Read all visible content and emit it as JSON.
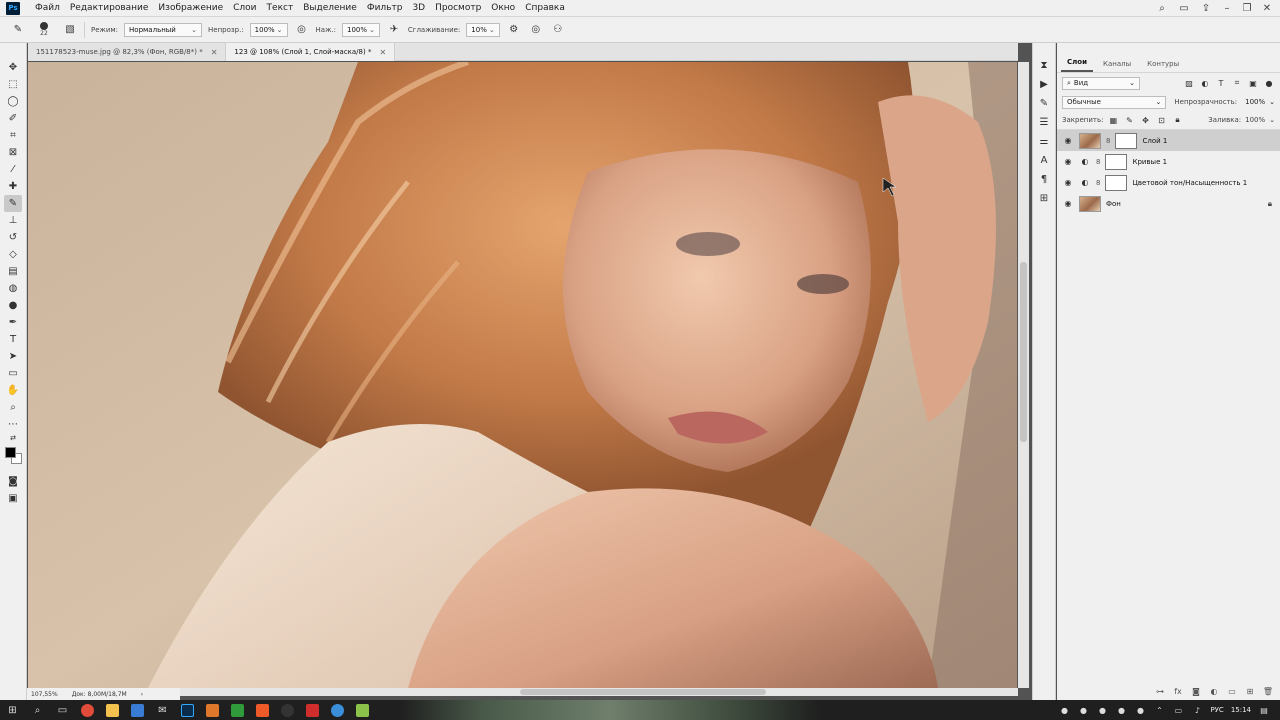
{
  "menu": {
    "logo": "Ps",
    "items": [
      "Файл",
      "Редактирование",
      "Изображение",
      "Слои",
      "Текст",
      "Выделение",
      "Фильтр",
      "3D",
      "Просмотр",
      "Окно",
      "Справка"
    ]
  },
  "options": {
    "brush_size": "22",
    "mode_label": "Режим:",
    "mode_value": "Нормальный",
    "opacity_label": "Непрозр.:",
    "opacity_value": "100%",
    "pressure_label": "Наж.:",
    "pressure_value": "100%",
    "smoothing_label": "Сглаживание:",
    "smoothing_value": "10%"
  },
  "tabs": [
    {
      "label": "151178523-muse.jpg @ 82,3% (Фон, RGB/8*) *"
    },
    {
      "label": "123 @ 108% (Слой 1, Слой-маска/8) *"
    }
  ],
  "status": {
    "zoom": "107,55%",
    "doc": "Док: 8,00M/18,7M"
  },
  "layers_panel": {
    "tabs": [
      "Слои",
      "Каналы",
      "Контуры"
    ],
    "filter_value": "Вид",
    "blend_value": "Обычные",
    "opacity_label": "Непрозрачность:",
    "opacity_value": "100%",
    "lock_label": "Закрепить:",
    "fill_label": "Заливка:",
    "fill_value": "100%",
    "layers": [
      {
        "name": "Слой 1",
        "selected": true
      },
      {
        "name": "Кривые 1",
        "selected": false
      },
      {
        "name": "Цветовой тон/Насыщенность 1",
        "selected": false
      },
      {
        "name": "Фон",
        "selected": false
      }
    ]
  },
  "taskbar": {
    "lang": "РУС",
    "time": "15:14"
  },
  "colors": {
    "foreground": "#000000",
    "background": "#ffffff"
  }
}
